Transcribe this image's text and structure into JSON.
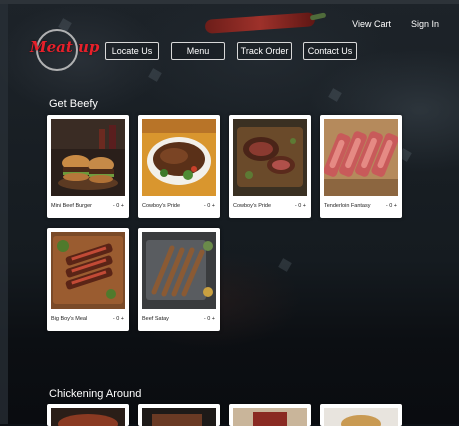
{
  "header": {
    "top_links": {
      "view_cart": "View Cart",
      "sign_in": "Sign In"
    },
    "logo_text": "Meat up",
    "nav": [
      {
        "label": "Locate Us"
      },
      {
        "label": "Menu"
      },
      {
        "label": "Track Order"
      },
      {
        "label": "Contact Us"
      }
    ]
  },
  "sections": [
    {
      "title": "Get Beefy",
      "items": [
        {
          "name": "Mini Beef Burger",
          "qty": "- 0 +",
          "image": "burger-photo"
        },
        {
          "name": "Cowboy's Pride",
          "qty": "- 0 +",
          "image": "steak-photo"
        },
        {
          "name": "Cowboy's Pride",
          "qty": "- 0 +",
          "image": "steak-board-photo"
        },
        {
          "name": "Tenderloin Fantasy",
          "qty": "- 0 +",
          "image": "tenderloin-photo"
        },
        {
          "name": "Big Boy's Meal",
          "qty": "- 0 +",
          "image": "sliced-steak-photo"
        },
        {
          "name": "Beef Satay",
          "qty": "- 0 +",
          "image": "satay-photo"
        }
      ]
    },
    {
      "title": "Chickening Around",
      "items": [
        {
          "image": "chicken-bowl-photo"
        },
        {
          "image": "chicken-dish-photo"
        },
        {
          "image": "chicken-plate-photo"
        },
        {
          "image": "chicken-burger-photo"
        }
      ]
    }
  ]
}
